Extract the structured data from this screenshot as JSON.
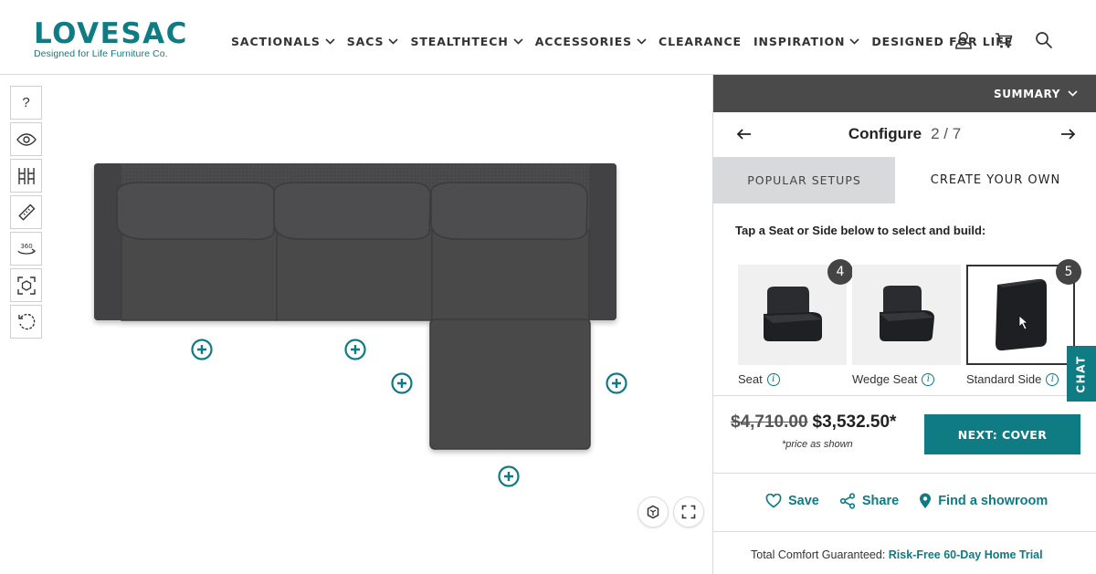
{
  "brand": {
    "name": "LOVESAC",
    "tagline": "Designed for Life Furniture Co.",
    "color": "#0f7b83"
  },
  "nav": {
    "items": [
      {
        "label": "SACTIONALS",
        "dropdown": true
      },
      {
        "label": "SACS",
        "dropdown": true
      },
      {
        "label": "STEALTHTECH",
        "dropdown": true
      },
      {
        "label": "ACCESSORIES",
        "dropdown": true
      },
      {
        "label": "CLEARANCE",
        "dropdown": false
      },
      {
        "label": "INSPIRATION",
        "dropdown": true
      },
      {
        "label": "DESIGNED FOR LIFE",
        "dropdown": false
      }
    ],
    "icons": [
      "user-icon",
      "cart-icon",
      "search-icon"
    ]
  },
  "toolbar": {
    "help_label": "?",
    "tools": [
      "help-icon",
      "eye-icon",
      "dimensions-icon",
      "ruler-icon",
      "rotate-360-icon",
      "ar-view-icon",
      "reset-icon"
    ],
    "rotate_label": "360"
  },
  "panel": {
    "summary_label": "SUMMARY",
    "configure_label": "Configure",
    "step": "2 / 7",
    "tabs": [
      {
        "label": "POPULAR SETUPS",
        "active": false
      },
      {
        "label": "CREATE YOUR OWN",
        "active": true
      }
    ],
    "instruction": "Tap a Seat or Side below to select and build:",
    "cards": [
      {
        "label": "Seat",
        "count": "4",
        "selected": false
      },
      {
        "label": "Wedge Seat",
        "count": "",
        "selected": false
      },
      {
        "label": "Standard Side",
        "count": "5",
        "selected": true
      }
    ],
    "price_original": "$4,710.00",
    "price_current": "$3,532.50*",
    "price_note": "*price as shown",
    "next_button": "NEXT: COVER",
    "actions": [
      {
        "label": "Save",
        "icon": "heart-icon"
      },
      {
        "label": "Share",
        "icon": "share-icon"
      },
      {
        "label": "Find a showroom",
        "icon": "location-pin-icon"
      }
    ],
    "guarantee_text": "Total Comfort Guaranteed:",
    "guarantee_link": "Risk-Free 60-Day Home Trial"
  },
  "chat": {
    "label": "CHAT"
  }
}
